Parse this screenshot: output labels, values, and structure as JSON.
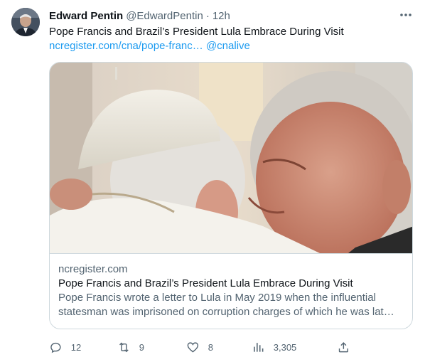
{
  "author": {
    "name": "Edward Pentin",
    "handle": "@EdwardPentin",
    "separator": "·",
    "time": "12h"
  },
  "tweet": {
    "text": "Pope Francis and Brazil’s President Lula Embrace During Visit",
    "link": "ncregister.com/cna/pope-franc…",
    "mention": "@cnalive"
  },
  "card": {
    "domain": "ncregister.com",
    "title": "Pope Francis and Brazil’s President Lula Embrace During Visit",
    "description": "Pope Francis wrote a letter to Lula in May 2019 when the influential statesman was imprisoned on corruption charges of which he was lat…"
  },
  "actions": {
    "replies": "12",
    "retweets": "9",
    "likes": "8",
    "views": "3,305"
  },
  "icons": {
    "more": "more-icon",
    "reply": "reply-icon",
    "retweet": "retweet-icon",
    "like": "heart-icon",
    "views": "views-icon",
    "share": "share-icon"
  },
  "colors": {
    "link": "#1d9bf0",
    "muted": "#536471",
    "text": "#0f1419",
    "border": "#cfd9de"
  }
}
